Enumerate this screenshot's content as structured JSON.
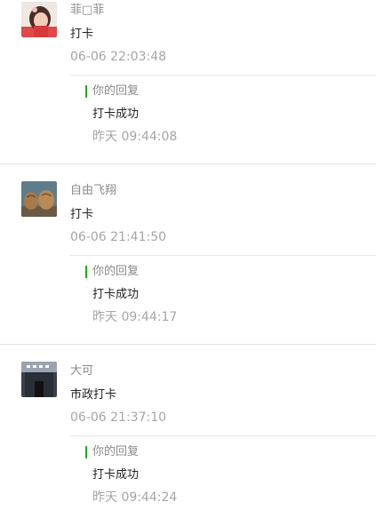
{
  "comments": [
    {
      "nickname": "菲□菲",
      "message": "打卡",
      "time": "06-06 22:03:48",
      "reply_header": "你的回复",
      "reply_message": "打卡成功",
      "reply_time": "昨天 09:44:08",
      "avatar_icon": "girl-photo-avatar"
    },
    {
      "nickname": "自由飞翔",
      "message": "打卡",
      "time": "06-06 21:41:50",
      "reply_header": "你的回复",
      "reply_message": "打卡成功",
      "reply_time": "昨天 09:44:17",
      "avatar_icon": "walnut-photo-avatar"
    },
    {
      "nickname": "大可",
      "message": "市政打卡",
      "time": "06-06 21:37:10",
      "reply_header": "你的回复",
      "reply_message": "打卡成功",
      "reply_time": "昨天 09:44:24",
      "avatar_icon": "building-photo-avatar"
    }
  ],
  "colors": {
    "reply_accent": "#1aad19",
    "muted_text": "#8a8a8a",
    "time_text": "#a6a6a6"
  }
}
